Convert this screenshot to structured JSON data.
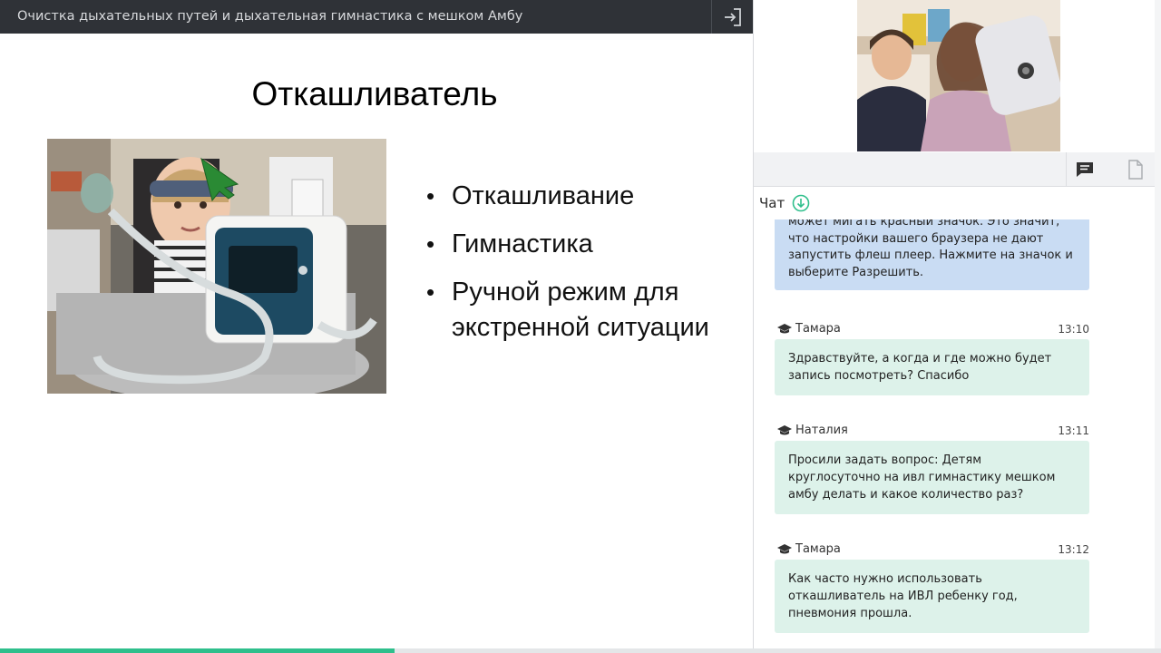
{
  "header": {
    "title": "Очистка дыхательных путей и дыхательная гимнастика с мешком Амбу"
  },
  "slide": {
    "title": "Откашливатель",
    "bullets": [
      "Откашливание",
      "Гимнастика",
      "Ручной режим для экстренной ситуации"
    ]
  },
  "progress": {
    "fraction": 0.34,
    "color": "#2fbf8c"
  },
  "chat": {
    "title": "Чат",
    "info_message": "может мигать красный значок. Это значит, что настройки вашего браузера не дают запустить флеш плеер. Нажмите на значок и выберите Разрешить.",
    "messages": [
      {
        "author": "Тамара",
        "time": "13:10",
        "text": "Здравствуйте, а когда и где можно будет запись посмотреть? Спасибо"
      },
      {
        "author": "Наталия",
        "time": "13:11",
        "text": "Просили задать вопрос: Детям круглосуточно на ивл гимнастику мешком амбу делать и какое количество раз?"
      },
      {
        "author": "Тамара",
        "time": "13:12",
        "text": "Как часто нужно использовать откашливатель на ИВЛ ребенку год, пневмония прошла."
      }
    ]
  },
  "icons": {
    "exit": "exit-icon",
    "chat": "chat-icon",
    "document": "document-icon",
    "scroll_down": "arrow-down-circle-icon",
    "author": "graduation-cap-icon"
  },
  "colors": {
    "topbar": "#2f3237",
    "accent": "#2fbf8c",
    "info_bubble": "#c9dcf3",
    "message_bubble": "#ddf2ea"
  }
}
